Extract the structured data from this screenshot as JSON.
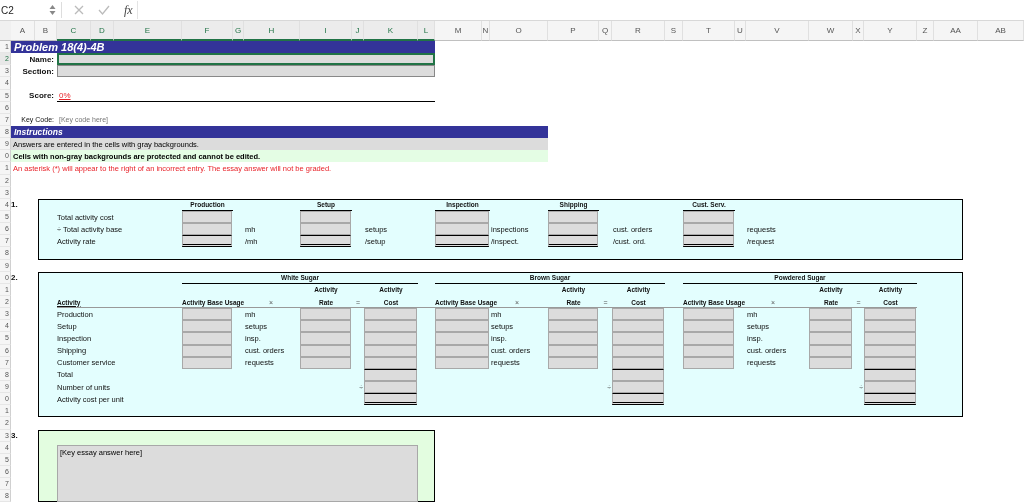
{
  "formula_bar": {
    "name_box": "C2",
    "function_label": "fx"
  },
  "column_headers": [
    {
      "label": "A",
      "selected": false
    },
    {
      "label": "B",
      "selected": false
    },
    {
      "label": "C",
      "selected": true
    },
    {
      "label": "D",
      "selected": true
    },
    {
      "label": "E",
      "selected": true
    },
    {
      "label": "F",
      "selected": true
    },
    {
      "label": "G",
      "selected": true
    },
    {
      "label": "H",
      "selected": true
    },
    {
      "label": "I",
      "selected": true
    },
    {
      "label": "J",
      "selected": true
    },
    {
      "label": "K",
      "selected": true
    },
    {
      "label": "L",
      "selected": true
    },
    {
      "label": "M",
      "selected": false
    },
    {
      "label": "N",
      "selected": false
    },
    {
      "label": "O",
      "selected": false
    },
    {
      "label": "P",
      "selected": false
    },
    {
      "label": "Q",
      "selected": false
    },
    {
      "label": "R",
      "selected": false
    },
    {
      "label": "S",
      "selected": false
    },
    {
      "label": "T",
      "selected": false
    },
    {
      "label": "U",
      "selected": false
    },
    {
      "label": "V",
      "selected": false
    },
    {
      "label": "W",
      "selected": false
    },
    {
      "label": "X",
      "selected": false
    },
    {
      "label": "Y",
      "selected": false
    },
    {
      "label": "Z",
      "selected": false
    },
    {
      "label": "AA",
      "selected": false
    },
    {
      "label": "AB",
      "selected": false
    }
  ],
  "row_headers": [
    {
      "label": "1",
      "selected": false
    },
    {
      "label": "2",
      "selected": true
    },
    {
      "label": "3",
      "selected": false
    },
    {
      "label": "4",
      "selected": false
    },
    {
      "label": "5",
      "selected": false
    },
    {
      "label": "6",
      "selected": false
    },
    {
      "label": "7",
      "selected": false
    },
    {
      "label": "8",
      "selected": false
    },
    {
      "label": "9",
      "selected": false
    },
    {
      "label": "0",
      "selected": false
    },
    {
      "label": "1",
      "selected": false
    },
    {
      "label": "2",
      "selected": false
    },
    {
      "label": "3",
      "selected": false
    },
    {
      "label": "4",
      "selected": false
    },
    {
      "label": "5",
      "selected": false
    },
    {
      "label": "6",
      "selected": false
    },
    {
      "label": "7",
      "selected": false
    },
    {
      "label": "8",
      "selected": false
    },
    {
      "label": "9",
      "selected": false
    },
    {
      "label": "0",
      "selected": false
    },
    {
      "label": "1",
      "selected": false
    },
    {
      "label": "2",
      "selected": false
    },
    {
      "label": "3",
      "selected": false
    },
    {
      "label": "4",
      "selected": false
    },
    {
      "label": "5",
      "selected": false
    },
    {
      "label": "6",
      "selected": false
    },
    {
      "label": "7",
      "selected": false
    },
    {
      "label": "8",
      "selected": false
    },
    {
      "label": "9",
      "selected": false
    },
    {
      "label": "0",
      "selected": false
    },
    {
      "label": "1",
      "selected": false
    },
    {
      "label": "2",
      "selected": false
    },
    {
      "label": "3",
      "selected": false
    },
    {
      "label": "4",
      "selected": false
    },
    {
      "label": "5",
      "selected": false
    },
    {
      "label": "6",
      "selected": false
    },
    {
      "label": "7",
      "selected": false
    },
    {
      "label": "8",
      "selected": false
    }
  ],
  "title": "Problem 18(4)-4B",
  "name_label": "Name:",
  "name_field": {
    "selected": true
  },
  "section_label": "Section:",
  "score_label": "Score:",
  "score": "0%",
  "key_code_label": "Key Code:",
  "key_code": "[Key code here]",
  "instructions": {
    "title": "Instructions",
    "lines": [
      {
        "kind": "gray",
        "text": "Answers are entered in the cells with gray backgrounds."
      },
      {
        "kind": "protected",
        "text": "Cells with non-gray backgrounds are protected and cannot be edited."
      },
      {
        "kind": "warning",
        "text": "An asterisk (*) will appear to the right of an incorrect entry. The essay answer will not be graded."
      }
    ]
  },
  "part1": {
    "number": "1.",
    "row_labels": [
      "Total activity cost",
      "÷ Total activity base",
      "Activity rate"
    ],
    "columns": [
      {
        "header": "Production",
        "units": [
          "mh",
          "/mh"
        ]
      },
      {
        "header": "Setup",
        "units": [
          "setups",
          "/setup"
        ]
      },
      {
        "header": "Inspection",
        "units": [
          "inspections",
          "/inspect."
        ]
      },
      {
        "header": "Shipping",
        "units": [
          "cust. orders",
          "/cust. ord."
        ]
      },
      {
        "header": "Cust. Serv.",
        "units": [
          "requests",
          "/request"
        ]
      }
    ]
  },
  "part2": {
    "number": "2.",
    "activity_header": "Activity",
    "activities": [
      "Production",
      "Setup",
      "Inspection",
      "Shipping",
      "Customer service"
    ],
    "total_labels": [
      "Total",
      "Number of units",
      "Activity cost per unit"
    ],
    "products": [
      {
        "name": "White Sugar",
        "usage_header": "Activity Base Usage",
        "times": "×",
        "rate_header": [
          "Activity",
          "Rate"
        ],
        "equals": "=",
        "cost_header": [
          "Activity",
          "Cost"
        ],
        "units": [
          "mh",
          "setups",
          "insp.",
          "cust. orders",
          "requests"
        ],
        "divide": "÷"
      },
      {
        "name": "Brown Sugar",
        "usage_header": "Activity Base Usage",
        "times": "×",
        "rate_header": [
          "Activity",
          "Rate"
        ],
        "equals": "=",
        "cost_header": [
          "Activity",
          "Cost"
        ],
        "units": [
          "mh",
          "setups",
          "insp.",
          "cust. orders",
          "requests"
        ],
        "divide": "÷"
      },
      {
        "name": "Powdered Sugar",
        "usage_header": "Activity Base Usage",
        "times": "×",
        "rate_header": [
          "Activity",
          "Rate"
        ],
        "equals": "=",
        "cost_header": [
          "Activity",
          "Cost"
        ],
        "units": [
          "mh",
          "setups",
          "insp.",
          "cust. orders",
          "requests"
        ],
        "divide": "÷"
      }
    ]
  },
  "part3": {
    "number": "3.",
    "essay": "[Key essay answer here]"
  }
}
